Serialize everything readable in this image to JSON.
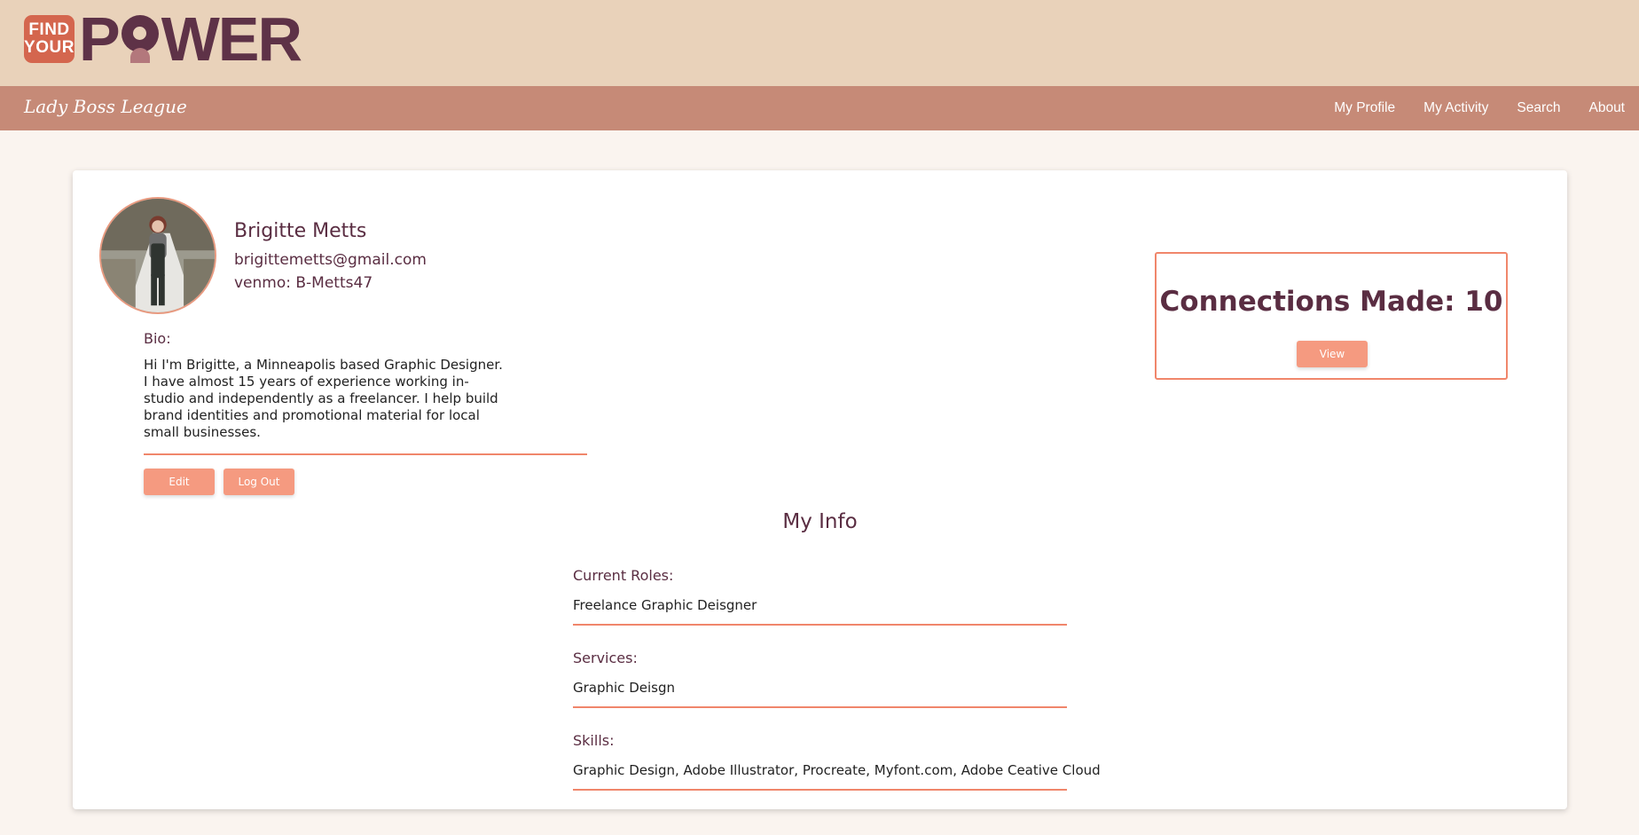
{
  "header": {
    "logo_small_top": "FIND",
    "logo_small_bottom": "YOUR",
    "logo_word_left": "P",
    "logo_word_right": "WER",
    "brand_color": "#5e3247",
    "badge_color": "#d4664e"
  },
  "nav": {
    "brand": "Lady Boss League",
    "links": [
      "My Profile",
      "My Activity",
      "Search",
      "About"
    ]
  },
  "profile": {
    "name": "Brigitte Metts",
    "email": "brigittemetts@gmail.com",
    "venmo": "venmo: B-Metts47",
    "bio_label": "Bio:",
    "bio": "Hi I'm Brigitte, a Minneapolis based Graphic Designer. I have almost 15 years of experience working in-studio and independently as a freelancer. I help build brand identities and promotional material for local small businesses.",
    "edit_label": "Edit",
    "logout_label": "Log Out"
  },
  "connections": {
    "title": "Connections Made: 10",
    "view_label": "View"
  },
  "my_info": {
    "title": "My Info",
    "roles_label": "Current Roles:",
    "roles": "Freelance Graphic Deisgner",
    "services_label": "Services:",
    "services": "Graphic Deisgn",
    "skills_label": "Skills:",
    "skills": "Graphic Design, Adobe Illustrator, Procreate, Myfont.com, Adobe Ceative Cloud"
  },
  "colors": {
    "accent": "#f59a80",
    "rule": "#f0866b",
    "topbar": "#e9d2ba",
    "navbar": "#c68a77",
    "text_heading": "#5a2d42"
  }
}
